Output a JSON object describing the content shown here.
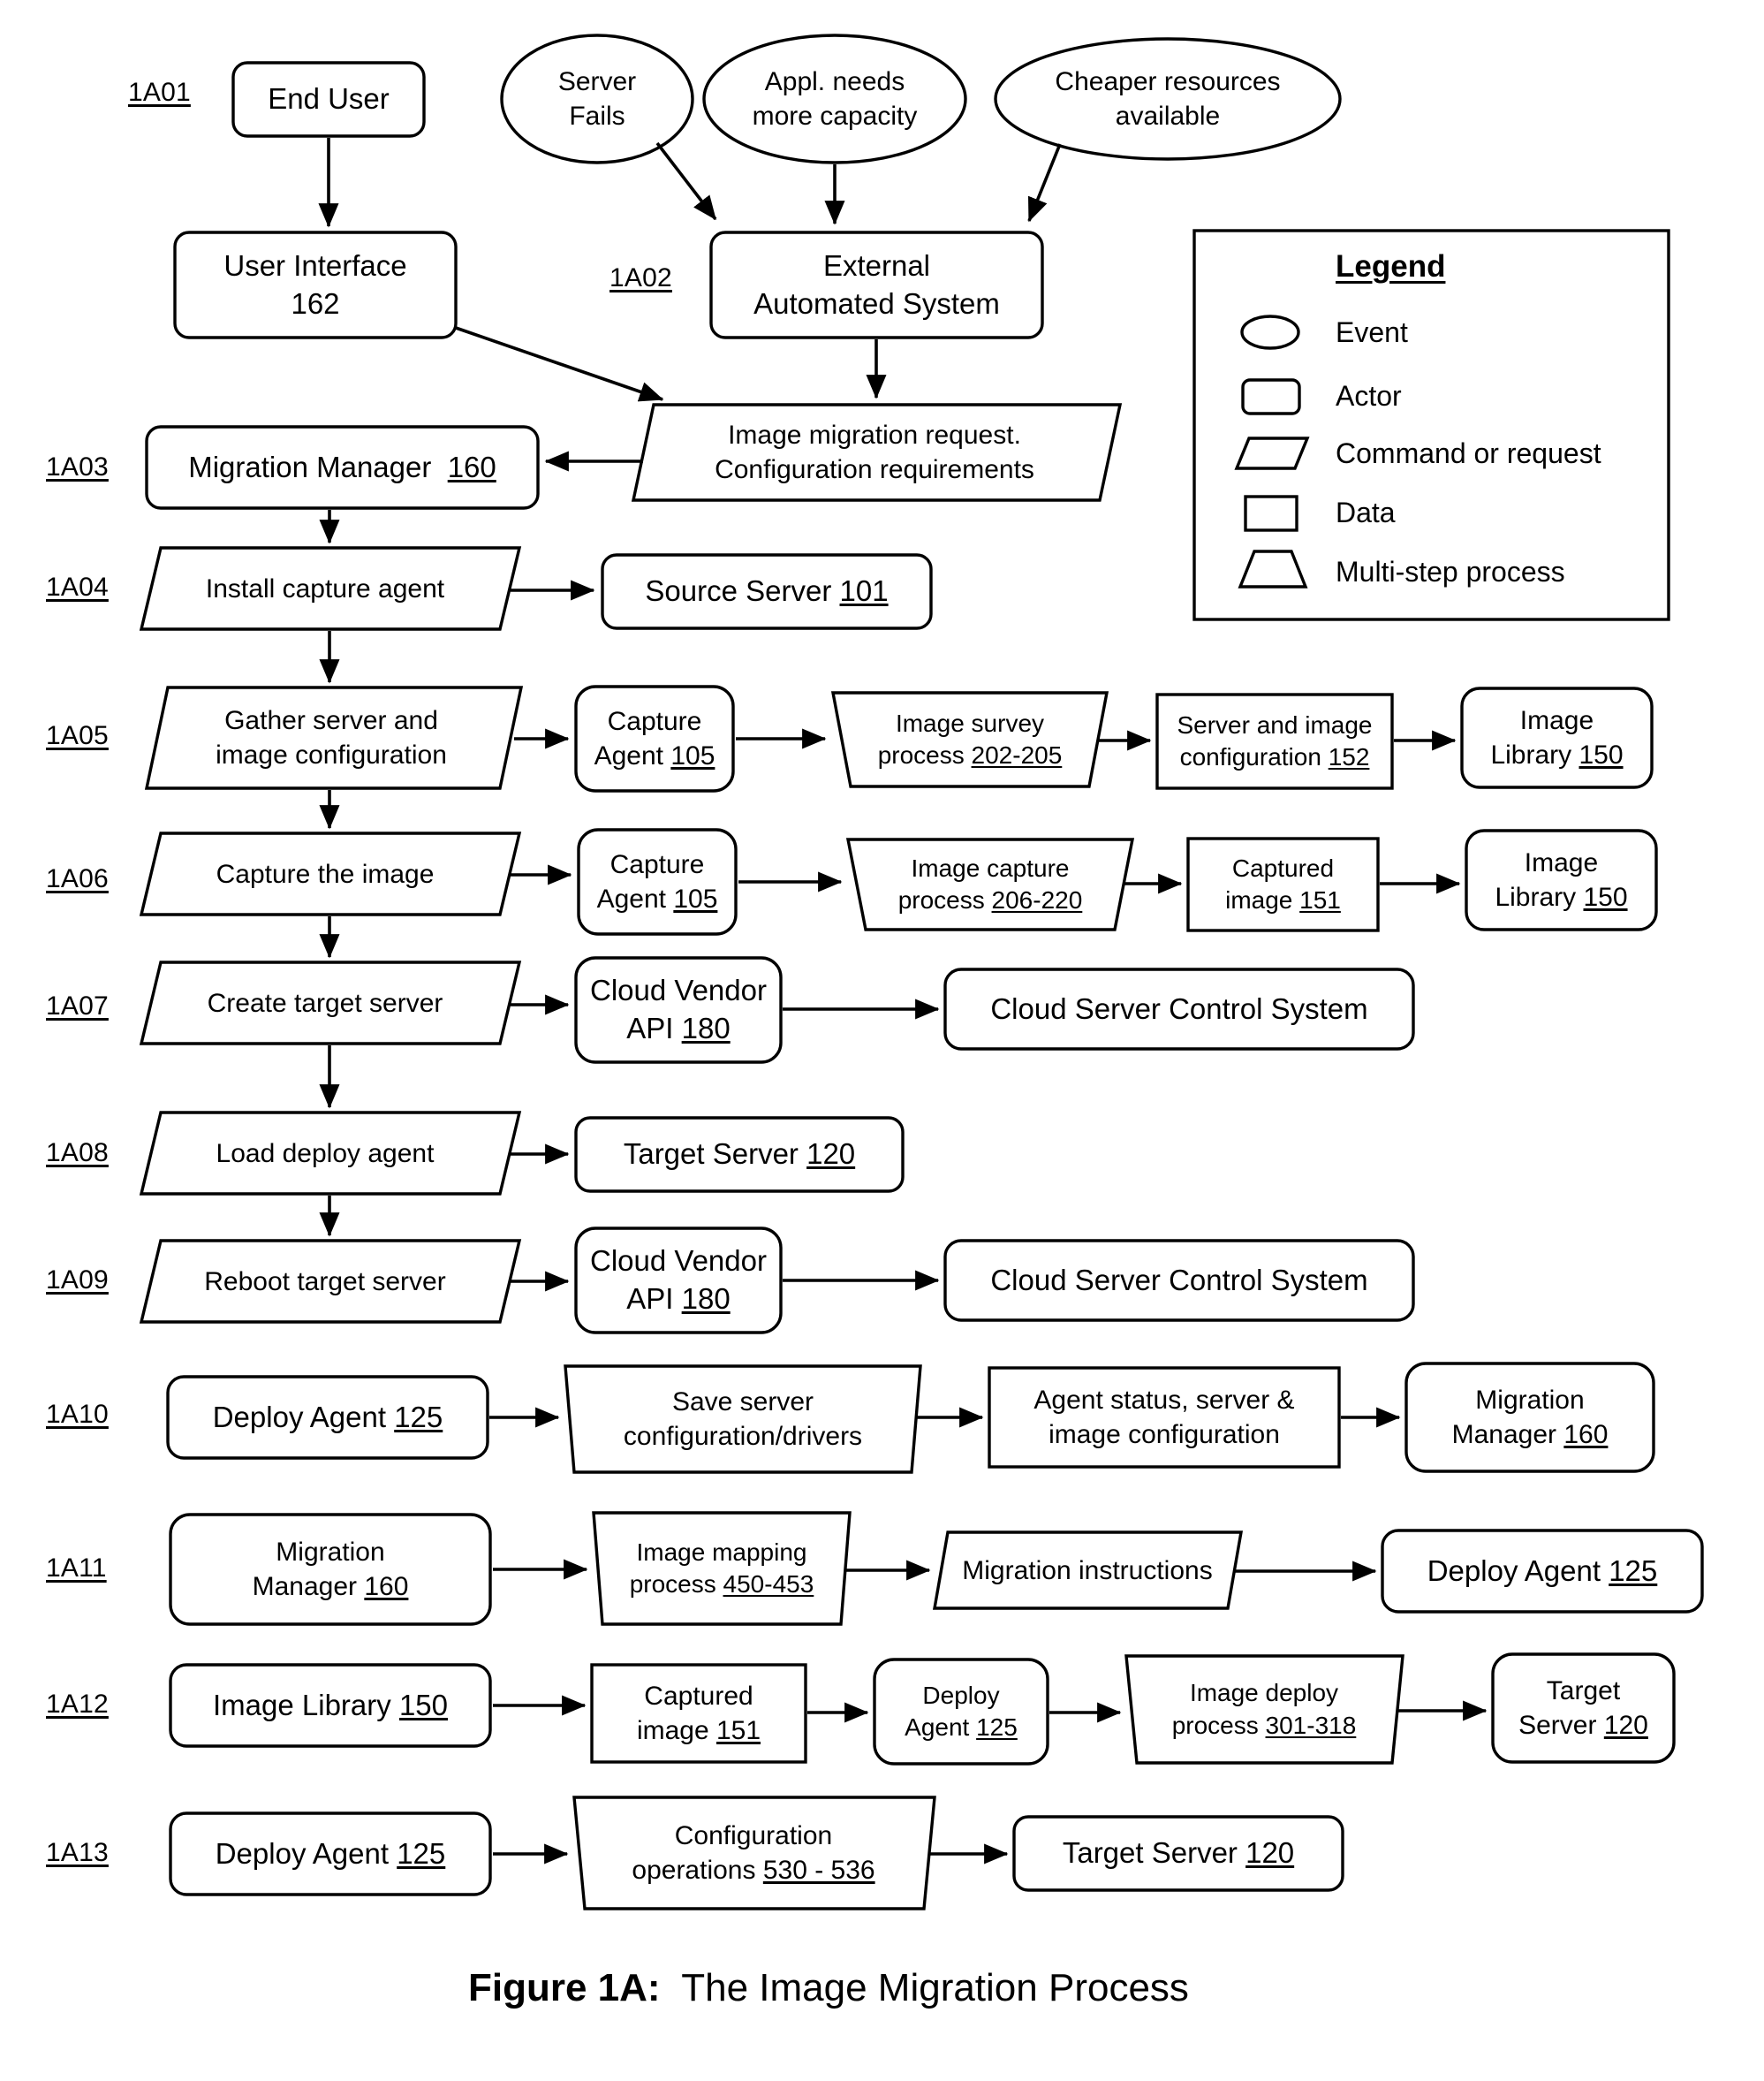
{
  "figure": {
    "caption_bold": "Figure 1A:",
    "caption_rest": "  The Image Migration Process"
  },
  "legend": {
    "title": "Legend",
    "items": [
      {
        "shape": "ellipse",
        "label": "Event"
      },
      {
        "shape": "rounded-rect",
        "label": "Actor"
      },
      {
        "shape": "parallelogram",
        "label": "Command or request"
      },
      {
        "shape": "rect",
        "label": "Data"
      },
      {
        "shape": "trapezoid",
        "label": "Multi-step process"
      }
    ]
  },
  "events": [
    {
      "name": "server-fails",
      "label": "Server\nFails"
    },
    {
      "name": "appl-needs-more-capacity",
      "label": "Appl. needs\nmore capacity"
    },
    {
      "name": "cheaper-resources",
      "label": "Cheaper resources\navailable"
    }
  ],
  "steps": [
    {
      "id": "1A01",
      "nodes": [
        {
          "name": "end-user",
          "shape": "rounded-rect",
          "label": "End User"
        },
        {
          "name": "user-interface",
          "shape": "rounded-rect",
          "label": "User Interface\n162",
          "ref": "162"
        }
      ]
    },
    {
      "id": "1A02",
      "nodes": [
        {
          "name": "external-automated-system",
          "shape": "rounded-rect",
          "label": "External\nAutomated System"
        },
        {
          "name": "image-migration-request",
          "shape": "parallelogram",
          "label": "Image migration request.\nConfiguration requirements"
        }
      ]
    },
    {
      "id": "1A03",
      "nodes": [
        {
          "name": "migration-manager-160",
          "shape": "rounded-rect",
          "label": "Migration Manager  160",
          "ref": "160"
        }
      ]
    },
    {
      "id": "1A04",
      "nodes": [
        {
          "name": "install-capture-agent",
          "shape": "parallelogram",
          "label": "Install capture agent"
        },
        {
          "name": "source-server-101",
          "shape": "rounded-rect",
          "label": "Source Server 101",
          "ref": "101"
        }
      ]
    },
    {
      "id": "1A05",
      "nodes": [
        {
          "name": "gather-server-and-image-configuration",
          "shape": "parallelogram",
          "label": "Gather server and\nimage configuration"
        },
        {
          "name": "capture-agent-105",
          "shape": "rounded-rect",
          "label": "Capture\nAgent 105",
          "ref": "105"
        },
        {
          "name": "image-survey-process",
          "shape": "trapezoid",
          "label": "Image survey\nprocess 202-205",
          "ref": "202-205"
        },
        {
          "name": "server-and-image-configuration-152",
          "shape": "rect",
          "label": "Server and image\nconfiguration 152",
          "ref": "152"
        },
        {
          "name": "image-library-150",
          "shape": "rounded-rect",
          "label": "Image\nLibrary 150",
          "ref": "150"
        }
      ]
    },
    {
      "id": "1A06",
      "nodes": [
        {
          "name": "capture-the-image",
          "shape": "parallelogram",
          "label": "Capture the image"
        },
        {
          "name": "capture-agent-105",
          "shape": "rounded-rect",
          "label": "Capture\nAgent 105",
          "ref": "105"
        },
        {
          "name": "image-capture-process",
          "shape": "trapezoid",
          "label": "Image capture\nprocess 206-220",
          "ref": "206-220"
        },
        {
          "name": "captured-image-151",
          "shape": "rect",
          "label": "Captured\nimage 151",
          "ref": "151"
        },
        {
          "name": "image-library-150",
          "shape": "rounded-rect",
          "label": "Image\nLibrary 150",
          "ref": "150"
        }
      ]
    },
    {
      "id": "1A07",
      "nodes": [
        {
          "name": "create-target-server",
          "shape": "parallelogram",
          "label": "Create target server"
        },
        {
          "name": "cloud-vendor-api-180",
          "shape": "rounded-rect",
          "label": "Cloud Vendor\nAPI 180",
          "ref": "180"
        },
        {
          "name": "cloud-server-control-system",
          "shape": "rounded-rect",
          "label": "Cloud Server Control System"
        }
      ]
    },
    {
      "id": "1A08",
      "nodes": [
        {
          "name": "load-deploy-agent",
          "shape": "parallelogram",
          "label": "Load deploy agent"
        },
        {
          "name": "target-server-120",
          "shape": "rounded-rect",
          "label": "Target Server 120",
          "ref": "120"
        }
      ]
    },
    {
      "id": "1A09",
      "nodes": [
        {
          "name": "reboot-target-server",
          "shape": "parallelogram",
          "label": "Reboot target server"
        },
        {
          "name": "cloud-vendor-api-180",
          "shape": "rounded-rect",
          "label": "Cloud Vendor\nAPI 180",
          "ref": "180"
        },
        {
          "name": "cloud-server-control-system",
          "shape": "rounded-rect",
          "label": "Cloud Server Control System"
        }
      ]
    },
    {
      "id": "1A10",
      "nodes": [
        {
          "name": "deploy-agent-125",
          "shape": "rounded-rect",
          "label": "Deploy Agent 125",
          "ref": "125"
        },
        {
          "name": "save-server-configuration-drivers",
          "shape": "trapezoid",
          "label": "Save server\nconfiguration/drivers"
        },
        {
          "name": "agent-status-server-image-config",
          "shape": "rect",
          "label": "Agent status, server &\nimage configuration"
        },
        {
          "name": "migration-manager-160",
          "shape": "rounded-rect",
          "label": "Migration\nManager 160",
          "ref": "160"
        }
      ]
    },
    {
      "id": "1A11",
      "nodes": [
        {
          "name": "migration-manager-160",
          "shape": "rounded-rect",
          "label": "Migration\nManager 160",
          "ref": "160"
        },
        {
          "name": "image-mapping-process",
          "shape": "trapezoid",
          "label": "Image mapping\nprocess 450-453",
          "ref": "450-453"
        },
        {
          "name": "migration-instructions",
          "shape": "parallelogram",
          "label": "Migration instructions"
        },
        {
          "name": "deploy-agent-125",
          "shape": "rounded-rect",
          "label": "Deploy Agent 125",
          "ref": "125"
        }
      ]
    },
    {
      "id": "1A12",
      "nodes": [
        {
          "name": "image-library-150",
          "shape": "rounded-rect",
          "label": "Image Library 150",
          "ref": "150"
        },
        {
          "name": "captured-image-151",
          "shape": "rect",
          "label": "Captured\nimage 151",
          "ref": "151"
        },
        {
          "name": "deploy-agent-125",
          "shape": "rounded-rect",
          "label": "Deploy\nAgent 125",
          "ref": "125"
        },
        {
          "name": "image-deploy-process",
          "shape": "trapezoid",
          "label": "Image deploy\nprocess 301-318",
          "ref": "301-318"
        },
        {
          "name": "target-server-120",
          "shape": "rounded-rect",
          "label": "Target\nServer 120",
          "ref": "120"
        }
      ]
    },
    {
      "id": "1A13",
      "nodes": [
        {
          "name": "deploy-agent-125",
          "shape": "rounded-rect",
          "label": "Deploy Agent 125",
          "ref": "125"
        },
        {
          "name": "configuration-operations",
          "shape": "trapezoid",
          "label": "Configuration\noperations 530 - 536",
          "ref": "530 - 536"
        },
        {
          "name": "target-server-120",
          "shape": "rounded-rect",
          "label": "Target Server 120",
          "ref": "120"
        }
      ]
    }
  ],
  "colors": {
    "stroke": "#000000",
    "fill": "#ffffff",
    "text": "#000000"
  }
}
